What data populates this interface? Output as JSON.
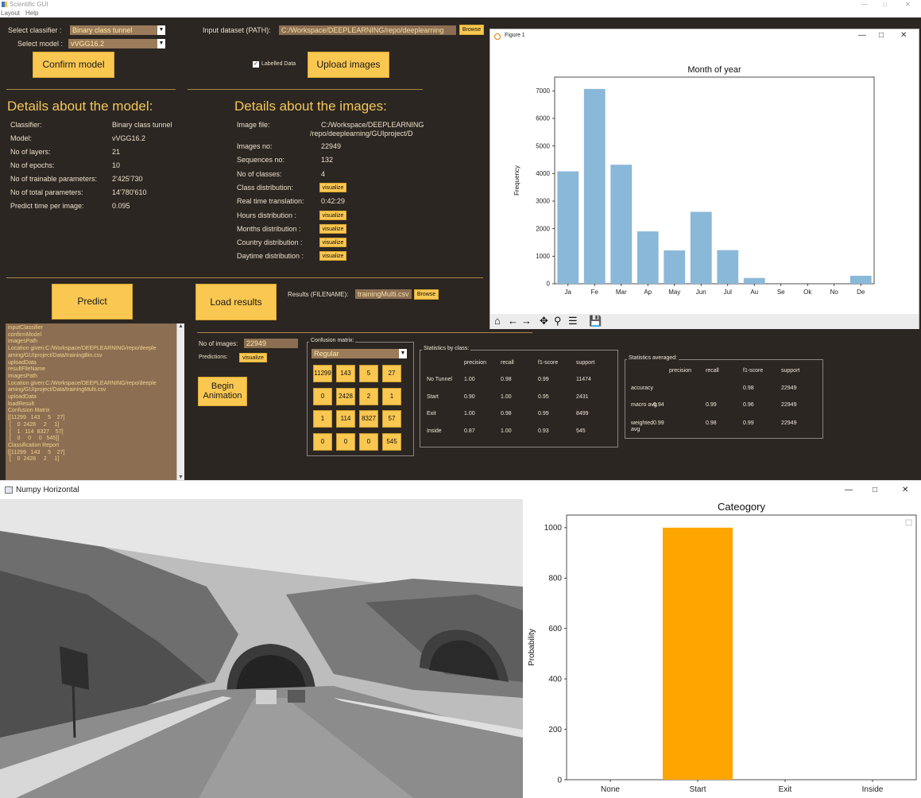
{
  "app": {
    "title": "Scientific GUI",
    "menu": [
      "Layout",
      "Help"
    ]
  },
  "top": {
    "classifier_label": "Select classifier :",
    "classifier_value": "Binary class tunnel",
    "model_label": "Select model :",
    "model_value": "vVGG16.2",
    "confirm_label": "Confirm model",
    "dataset_label": "Input dataset (PATH):",
    "dataset_value": "C:/Workspace/DEEPLEARNING/repo/deeplearning",
    "browse_label": "Browse",
    "labelled_label": "Labelled Data",
    "upload_label": "Upload images"
  },
  "model": {
    "heading": "Details about the model:",
    "rows": [
      {
        "k": "Classifier:",
        "v": "Binary class tunnel"
      },
      {
        "k": "Model:",
        "v": "vVGG16.2"
      },
      {
        "k": "No of layers:",
        "v": "21"
      },
      {
        "k": "No of epochs:",
        "v": "10"
      },
      {
        "k": "No of trainable parameters:",
        "v": "2'425'730"
      },
      {
        "k": "No of total parameters:",
        "v": "14'780'610"
      },
      {
        "k": "Predict time per image:",
        "v": "0.095"
      }
    ]
  },
  "images": {
    "heading": "Details about the images:",
    "file_label": "Image file:",
    "file_value_1": "C:/Workspace/DEEPLEARNING",
    "file_value_2": "/repo/deeplearning/GUIproject/D",
    "rows": [
      {
        "k": "Images no:",
        "v": "22949"
      },
      {
        "k": "Sequences no:",
        "v": "132"
      },
      {
        "k": "No of classes:",
        "v": "4"
      },
      {
        "k": "Class distribution:",
        "v": "visualize"
      },
      {
        "k": "Real time translation:",
        "v": "0:42:29"
      },
      {
        "k": "Hours distribution :",
        "v": "visualize"
      },
      {
        "k": "Months distribution :",
        "v": "visualize"
      },
      {
        "k": "Country distribution :",
        "v": "visualize"
      },
      {
        "k": "Daytime distribution :",
        "v": "visualize"
      }
    ]
  },
  "actions": {
    "predict": "Predict",
    "load_results": "Load results",
    "results_label": "Results (FILENAME):",
    "results_value": "trainingMulti.csv",
    "browse": "Browse",
    "begin_animation_1": "Begin",
    "begin_animation_2": "Animation"
  },
  "console": {
    "text": "inputClassifier\nconfirmModel\nimagesPath\nLocation given:C:/Workspace/DEEPLEARNING/repo/deeple\naming/GUIproject/Data/trainingBin.csv\nuploadData\nresultFileName\nimagesPath\nLocation given:C:/Workspace/DEEPLEARNING/repo/deeple\naming/GUIproject/Data/trainingMulti.csv\nuploadData\nloadResult\nConfusion Matrix\n[[11299   143     5    27]\n [    0  2428     2     1]\n [    1   114  8327    57]\n [    0     0     0   545]]\nClassification Report\n[[11299   143     5    27]\n [    0  2428     2     1]"
  },
  "results": {
    "nimages_label": "No of images:",
    "nimages_value": "22949",
    "predictions_label": "Predictions:",
    "predictions_btn": "visualize",
    "confusion_title": "Confusion matrix:",
    "confusion_mode": "Regular",
    "confusion": [
      [
        "11299",
        "143",
        "5",
        "27"
      ],
      [
        "0",
        "2428",
        "2",
        "1"
      ],
      [
        "1",
        "114",
        "8327",
        "57"
      ],
      [
        "0",
        "0",
        "0",
        "545"
      ]
    ],
    "class_title": "Statistics by class:",
    "class_headers": [
      "precision",
      "recall",
      "f1-score",
      "support"
    ],
    "class_rows": [
      {
        "name": "No Tunnel",
        "vals": [
          "1.00",
          "0.98",
          "0.99",
          "11474"
        ]
      },
      {
        "name": "Start",
        "vals": [
          "0.90",
          "1.00",
          "0.95",
          "2431"
        ]
      },
      {
        "name": "Exit",
        "vals": [
          "1.00",
          "0.98",
          "0.99",
          "8499"
        ]
      },
      {
        "name": "Inside",
        "vals": [
          "0.87",
          "1.00",
          "0.93",
          "545"
        ]
      }
    ],
    "avg_title": "Statistics averaged:",
    "avg_headers": [
      "precision",
      "recall",
      "f1-score",
      "support"
    ],
    "avg_rows": [
      {
        "name": "accuracy",
        "vals": [
          "",
          "",
          "0.98",
          "22949"
        ]
      },
      {
        "name": "macro avg",
        "vals": [
          "0.94",
          "0.99",
          "0.96",
          "22949"
        ]
      },
      {
        "name": "weighted avg",
        "vals": [
          "0.99",
          "0.98",
          "0.99",
          "22949"
        ]
      }
    ]
  },
  "figure1": {
    "window_title": "Figure 1"
  },
  "numpy_window": {
    "title": "Numpy Horizontal"
  },
  "colors": {
    "app_bg": "#2b2622",
    "accent": "#fac751",
    "bar_blue": "#8ab8d9",
    "bar_orange": "#ffa500"
  },
  "chart_data": [
    {
      "type": "bar",
      "title": "Month of year",
      "xlabel": "",
      "ylabel": "Frequency",
      "categories": [
        "Ja",
        "Fe",
        "Mar",
        "Ap",
        "May",
        "Jun",
        "Jul",
        "Au",
        "Se",
        "Ok",
        "No",
        "De"
      ],
      "values": [
        4080,
        7070,
        4320,
        1900,
        1210,
        2610,
        1220,
        210,
        0,
        0,
        0,
        290
      ],
      "ylim": [
        0,
        7500
      ],
      "yticks": [
        0,
        1000,
        2000,
        3000,
        4000,
        5000,
        6000,
        7000
      ],
      "grid": false
    },
    {
      "type": "bar",
      "title": "Cateogory",
      "xlabel": "",
      "ylabel": "Probability",
      "categories": [
        "None",
        "Start",
        "Exit",
        "Inside"
      ],
      "values": [
        0,
        1000,
        0,
        0
      ],
      "ylim": [
        0,
        1050
      ],
      "yticks": [
        0,
        200,
        400,
        600,
        800,
        1000
      ],
      "grid": false
    }
  ]
}
